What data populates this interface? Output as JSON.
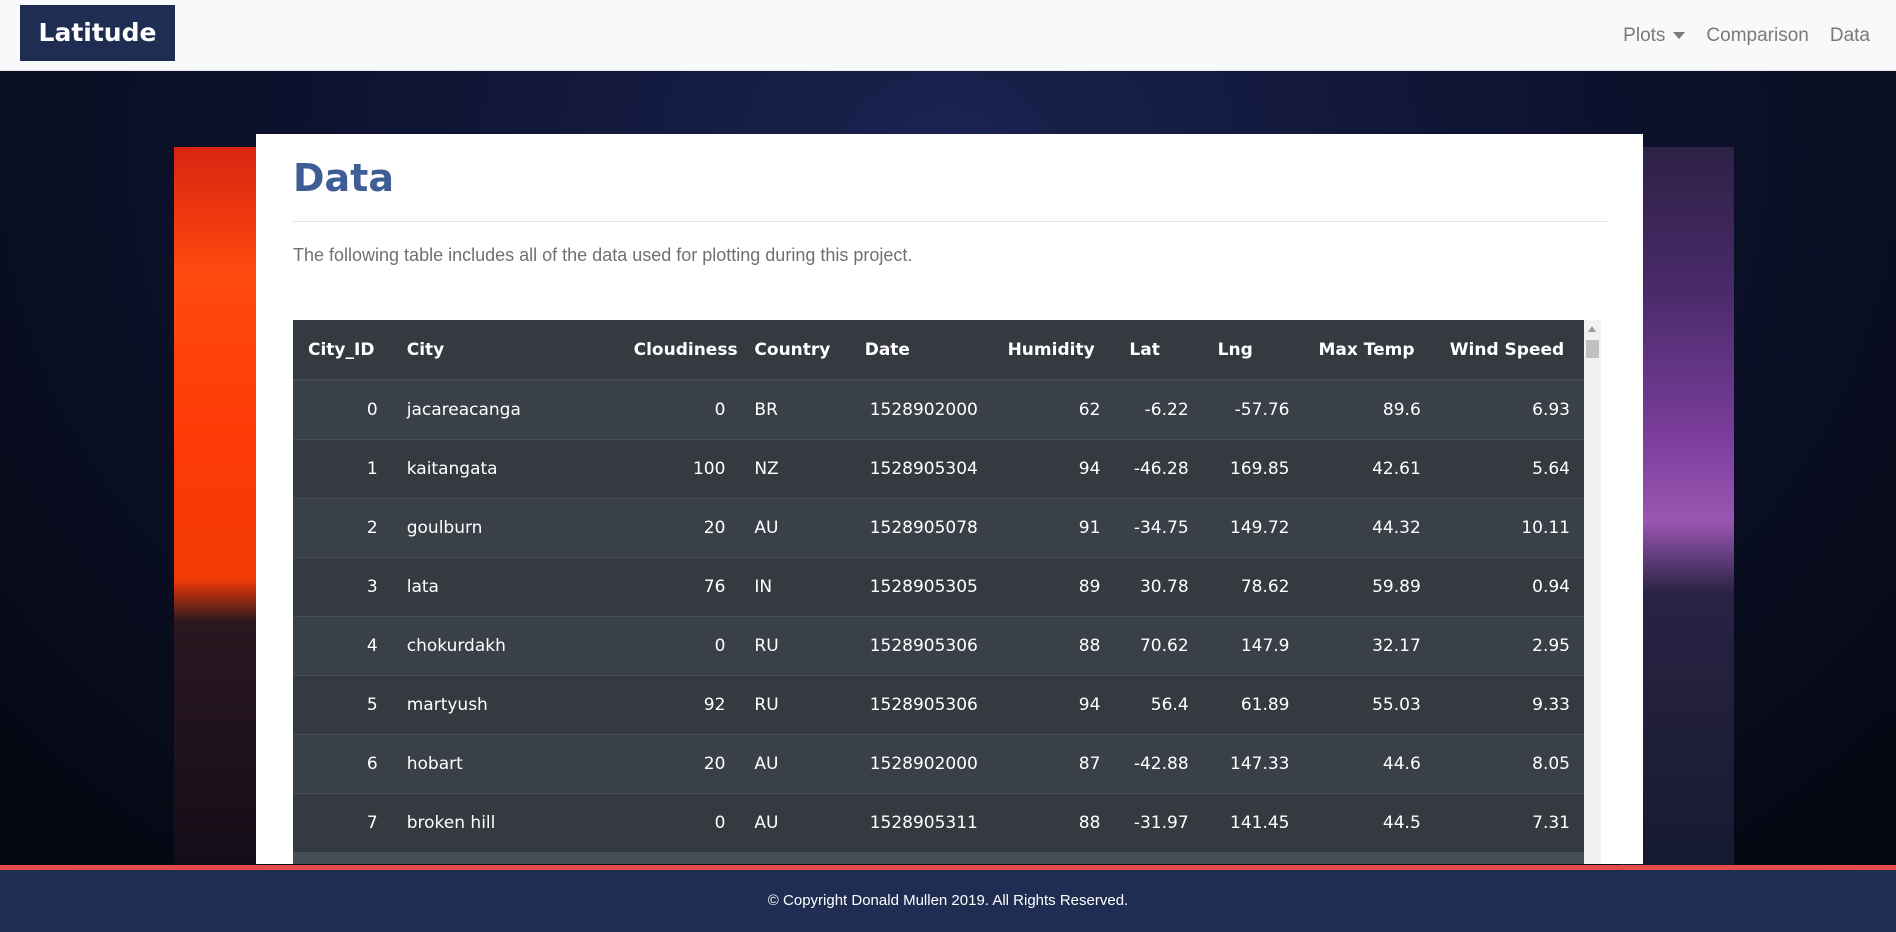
{
  "navbar": {
    "brand": "Latitude",
    "links": [
      {
        "label": "Plots",
        "dropdown": true
      },
      {
        "label": "Comparison"
      },
      {
        "label": "Data"
      }
    ]
  },
  "page": {
    "title": "Data",
    "intro": "The following table includes all of the data used for plotting during this project."
  },
  "table": {
    "columns": [
      "City_ID",
      "City",
      "Cloudiness",
      "Country",
      "Date",
      "Humidity",
      "Lat",
      "Lng",
      "Max Temp",
      "Wind Speed"
    ],
    "rows": [
      [
        "0",
        "jacareacanga",
        "0",
        "BR",
        "1528902000",
        "62",
        "-6.22",
        "-57.76",
        "89.6",
        "6.93"
      ],
      [
        "1",
        "kaitangata",
        "100",
        "NZ",
        "1528905304",
        "94",
        "-46.28",
        "169.85",
        "42.61",
        "5.64"
      ],
      [
        "2",
        "goulburn",
        "20",
        "AU",
        "1528905078",
        "91",
        "-34.75",
        "149.72",
        "44.32",
        "10.11"
      ],
      [
        "3",
        "lata",
        "76",
        "IN",
        "1528905305",
        "89",
        "30.78",
        "78.62",
        "59.89",
        "0.94"
      ],
      [
        "4",
        "chokurdakh",
        "0",
        "RU",
        "1528905306",
        "88",
        "70.62",
        "147.9",
        "32.17",
        "2.95"
      ],
      [
        "5",
        "martyush",
        "92",
        "RU",
        "1528905306",
        "94",
        "56.4",
        "61.89",
        "55.03",
        "9.33"
      ],
      [
        "6",
        "hobart",
        "20",
        "AU",
        "1528902000",
        "87",
        "-42.88",
        "147.33",
        "44.6",
        "8.05"
      ],
      [
        "7",
        "broken hill",
        "0",
        "AU",
        "1528905311",
        "88",
        "-31.97",
        "141.45",
        "44.5",
        "7.31"
      ]
    ]
  },
  "footer": {
    "text": "© Copyright Donald Mullen 2019. All Rights Reserved."
  },
  "colors": {
    "brand_bg": "#1f2d52",
    "title": "#3e5e95",
    "footer_accent": "#e64b4b",
    "table_dark": "#343a40"
  },
  "icons": {
    "dropdown": "chevron-down-icon",
    "scroll_up": "arrow-up-icon"
  }
}
